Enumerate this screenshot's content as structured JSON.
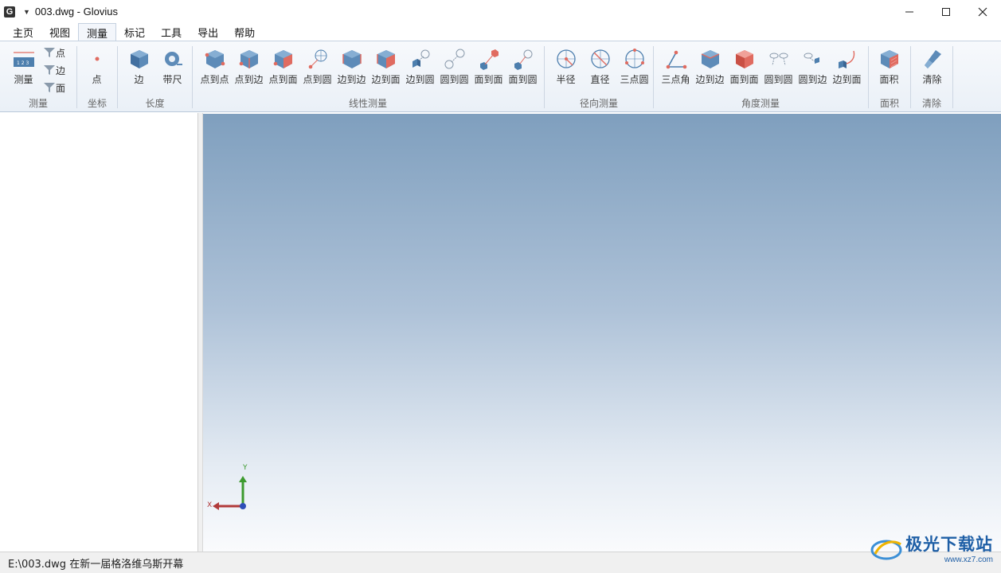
{
  "window": {
    "app_icon_letter": "G",
    "title": "003.dwg - Glovius"
  },
  "menu": {
    "tabs": [
      "主页",
      "视图",
      "测量",
      "标记",
      "工具",
      "导出",
      "帮助"
    ],
    "active": "测量"
  },
  "ribbon": {
    "measure": {
      "label": "测量",
      "main": "测量",
      "filters": [
        "点",
        "边",
        "面"
      ]
    },
    "coord": {
      "label": "坐标",
      "point": "点"
    },
    "length": {
      "label": "长度",
      "edge": "边",
      "tape": "带尺"
    },
    "linear": {
      "label": "线性测量",
      "buttons": [
        "点到点",
        "点到边",
        "点到面",
        "点到圆",
        "边到边",
        "边到面",
        "边到圆",
        "圆到圆",
        "面到面",
        "面到圆"
      ]
    },
    "radial": {
      "label": "径向测量",
      "buttons": [
        "半径",
        "直径",
        "三点圆"
      ]
    },
    "angle": {
      "label": "角度测量",
      "buttons": [
        "三点角",
        "边到边",
        "面到面",
        "圆到圆",
        "圆到边",
        "边到面"
      ]
    },
    "area": {
      "label": "面积",
      "button": "面积"
    },
    "clear": {
      "label": "清除",
      "button": "清除"
    }
  },
  "axis": {
    "x": "X",
    "y": "Y"
  },
  "status": {
    "text": "E:\\003.dwg 在新一届格洛维乌斯开幕"
  },
  "watermark": {
    "text": "极光下载站",
    "url": "www.xz7.com"
  },
  "colors": {
    "accent_blue": "#4d7fae",
    "cube_red": "#e06b60",
    "axis_x": "#b13a3a",
    "axis_y": "#3c9a2e"
  }
}
